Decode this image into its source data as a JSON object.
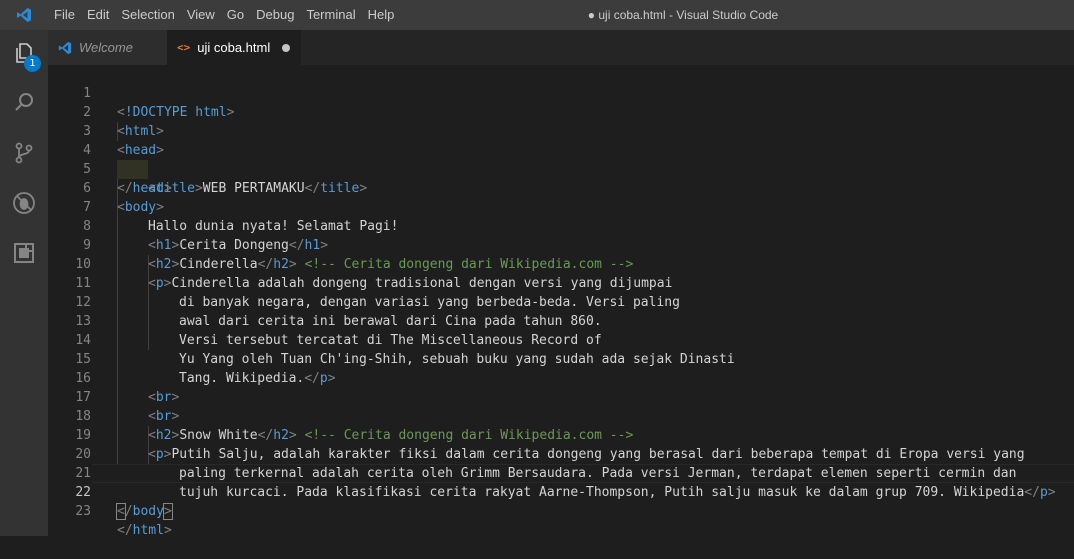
{
  "titlebar": {
    "menu": [
      "File",
      "Edit",
      "Selection",
      "View",
      "Go",
      "Debug",
      "Terminal",
      "Help"
    ],
    "window_title": "● uji coba.html - Visual Studio Code"
  },
  "activitybar": {
    "items": [
      {
        "icon": "explorer-icon",
        "badge": "1"
      },
      {
        "icon": "search-icon"
      },
      {
        "icon": "source-control-icon"
      },
      {
        "icon": "debug-icon"
      },
      {
        "icon": "extensions-icon"
      }
    ]
  },
  "tabs": [
    {
      "label": "Welcome",
      "icon": "vscode-icon",
      "active": false
    },
    {
      "label": "uji coba.html",
      "icon": "html-file-icon",
      "active": true,
      "dirty": true
    }
  ],
  "editor": {
    "current_line": 22,
    "lines": [
      "1",
      "2",
      "3",
      "4",
      "5",
      "6",
      "7",
      "8",
      "9",
      "10",
      "11",
      "12",
      "13",
      "14",
      "15",
      "16",
      "17",
      "18",
      "19",
      "20",
      "21",
      "22",
      "23"
    ],
    "code": {
      "l1_doctype": "<!DOCTYPE",
      "l1_html": "html",
      "l1_close": ">",
      "title_text": "WEB PERTAMAKU",
      "l7_text": "Hallo dunia nyata! Selamat Pagi!",
      "h1_text": "Cerita Dongeng",
      "h2_a_text": "Cinderella",
      "comment": "<!-- Cerita dongeng dari Wikipedia.com -->",
      "p1_l10": "Cinderella adalah dongeng tradisional dengan versi yang dijumpai",
      "p1_l11": "di banyak negara, dengan variasi yang berbeda-beda. Versi paling",
      "p1_l12": "awal dari cerita ini berawal dari Cina pada tahun 860.",
      "p1_l13": "Versi tersebut tercatat di The Miscellaneous Record of",
      "p1_l14": "Yu Yang oleh Tuan Ch'ing-Shih, sebuah buku yang sudah ada sejak Dinasti",
      "p1_l15": "Tang. Wikipedia.",
      "h2_b_text": "Snow White",
      "p2_l19": "Putih Salju, adalah karakter fiksi dalam cerita dongeng yang berasal dari beberapa tempat di Eropa versi yang",
      "p2_l20": "paling terkernal adalah cerita oleh Grimm Bersaudara. Pada versi Jerman, terdapat elemen seperti cermin dan",
      "p2_l21": "tujuh kurcaci. Pada klasifikasi cerita rakyat Aarne-Thompson, Putih salju masuk ke dalam grup 709. Wikipedia"
    }
  },
  "colors": {
    "tag": "#569cd6",
    "bracket": "#808080",
    "comment": "#6a9955",
    "text": "#d4d4d4",
    "accent": "#007acc"
  }
}
